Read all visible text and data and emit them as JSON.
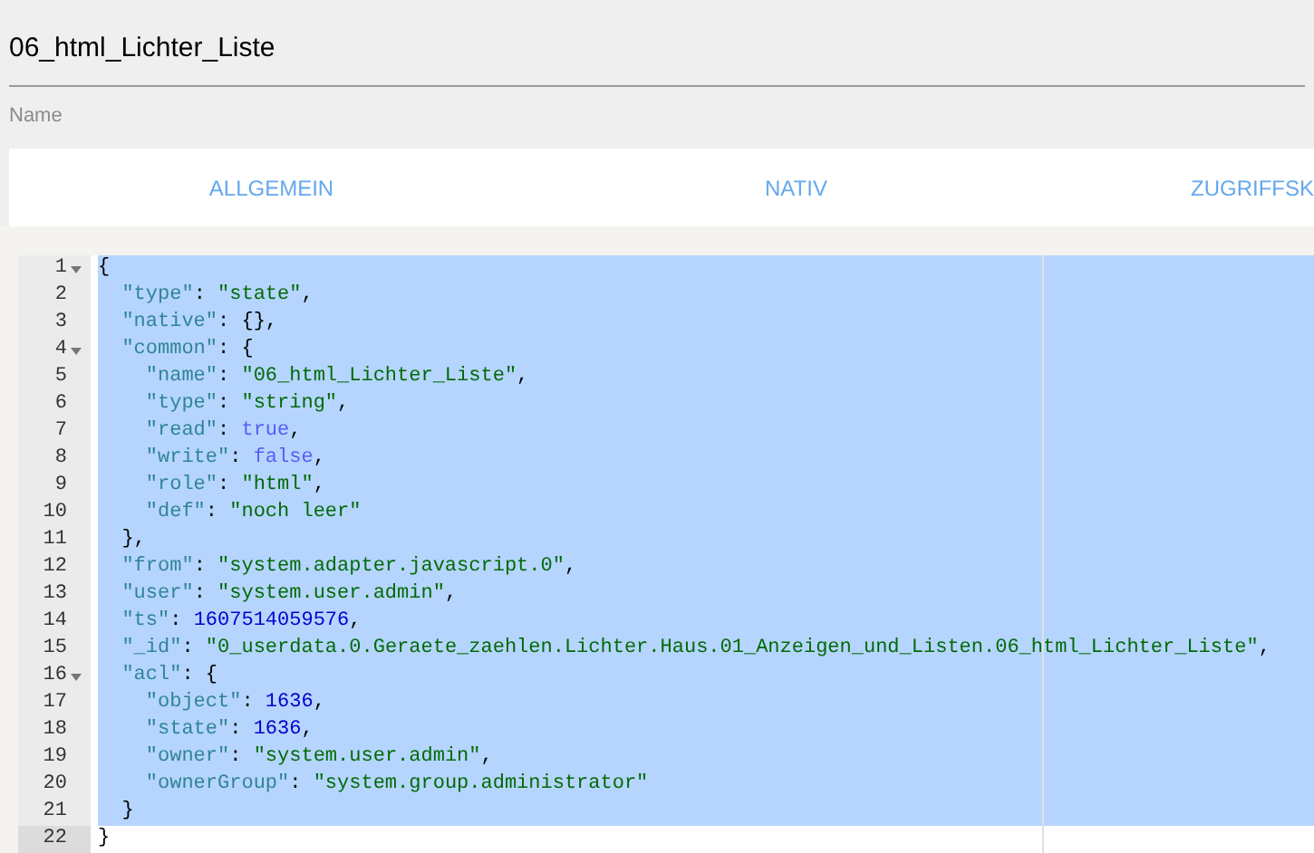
{
  "title": "06_html_Lichter_Liste",
  "name_label": "Name",
  "tabs": [
    {
      "label": "ALLGEMEIN"
    },
    {
      "label": "NATIV"
    },
    {
      "label": "ZUGRIFFSK"
    }
  ],
  "editor": {
    "lines": [
      {
        "number": "1",
        "fold": true,
        "active": false,
        "selected": true,
        "tokens": [
          {
            "kind": "punct",
            "text": "{"
          }
        ]
      },
      {
        "number": "2",
        "fold": false,
        "active": false,
        "selected": true,
        "tokens": [
          {
            "kind": "key",
            "text": "  \"type\""
          },
          {
            "kind": "punct",
            "text": ": "
          },
          {
            "kind": "string",
            "text": "\"state\""
          },
          {
            "kind": "punct",
            "text": ","
          }
        ]
      },
      {
        "number": "3",
        "fold": false,
        "active": false,
        "selected": true,
        "tokens": [
          {
            "kind": "key",
            "text": "  \"native\""
          },
          {
            "kind": "punct",
            "text": ": {},"
          }
        ]
      },
      {
        "number": "4",
        "fold": true,
        "active": false,
        "selected": true,
        "tokens": [
          {
            "kind": "key",
            "text": "  \"common\""
          },
          {
            "kind": "punct",
            "text": ": {"
          }
        ]
      },
      {
        "number": "5",
        "fold": false,
        "active": false,
        "selected": true,
        "tokens": [
          {
            "kind": "key",
            "text": "    \"name\""
          },
          {
            "kind": "punct",
            "text": ": "
          },
          {
            "kind": "string",
            "text": "\"06_html_Lichter_Liste\""
          },
          {
            "kind": "punct",
            "text": ","
          }
        ]
      },
      {
        "number": "6",
        "fold": false,
        "active": false,
        "selected": true,
        "tokens": [
          {
            "kind": "key",
            "text": "    \"type\""
          },
          {
            "kind": "punct",
            "text": ": "
          },
          {
            "kind": "string",
            "text": "\"string\""
          },
          {
            "kind": "punct",
            "text": ","
          }
        ]
      },
      {
        "number": "7",
        "fold": false,
        "active": false,
        "selected": true,
        "tokens": [
          {
            "kind": "key",
            "text": "    \"read\""
          },
          {
            "kind": "punct",
            "text": ": "
          },
          {
            "kind": "boolean",
            "text": "true"
          },
          {
            "kind": "punct",
            "text": ","
          }
        ]
      },
      {
        "number": "8",
        "fold": false,
        "active": false,
        "selected": true,
        "tokens": [
          {
            "kind": "key",
            "text": "    \"write\""
          },
          {
            "kind": "punct",
            "text": ": "
          },
          {
            "kind": "boolean",
            "text": "false"
          },
          {
            "kind": "punct",
            "text": ","
          }
        ]
      },
      {
        "number": "9",
        "fold": false,
        "active": false,
        "selected": true,
        "tokens": [
          {
            "kind": "key",
            "text": "    \"role\""
          },
          {
            "kind": "punct",
            "text": ": "
          },
          {
            "kind": "string",
            "text": "\"html\""
          },
          {
            "kind": "punct",
            "text": ","
          }
        ]
      },
      {
        "number": "10",
        "fold": false,
        "active": false,
        "selected": true,
        "tokens": [
          {
            "kind": "key",
            "text": "    \"def\""
          },
          {
            "kind": "punct",
            "text": ": "
          },
          {
            "kind": "string",
            "text": "\"noch leer\""
          }
        ]
      },
      {
        "number": "11",
        "fold": false,
        "active": false,
        "selected": true,
        "tokens": [
          {
            "kind": "punct",
            "text": "  },"
          }
        ]
      },
      {
        "number": "12",
        "fold": false,
        "active": false,
        "selected": true,
        "tokens": [
          {
            "kind": "key",
            "text": "  \"from\""
          },
          {
            "kind": "punct",
            "text": ": "
          },
          {
            "kind": "string",
            "text": "\"system.adapter.javascript.0\""
          },
          {
            "kind": "punct",
            "text": ","
          }
        ]
      },
      {
        "number": "13",
        "fold": false,
        "active": false,
        "selected": true,
        "tokens": [
          {
            "kind": "key",
            "text": "  \"user\""
          },
          {
            "kind": "punct",
            "text": ": "
          },
          {
            "kind": "string",
            "text": "\"system.user.admin\""
          },
          {
            "kind": "punct",
            "text": ","
          }
        ]
      },
      {
        "number": "14",
        "fold": false,
        "active": false,
        "selected": true,
        "tokens": [
          {
            "kind": "key",
            "text": "  \"ts\""
          },
          {
            "kind": "punct",
            "text": ": "
          },
          {
            "kind": "number",
            "text": "1607514059576"
          },
          {
            "kind": "punct",
            "text": ","
          }
        ]
      },
      {
        "number": "15",
        "fold": false,
        "active": false,
        "selected": true,
        "tokens": [
          {
            "kind": "key",
            "text": "  \"_id\""
          },
          {
            "kind": "punct",
            "text": ": "
          },
          {
            "kind": "string",
            "text": "\"0_userdata.0.Geraete_zaehlen.Lichter.Haus.01_Anzeigen_und_Listen.06_html_Lichter_Liste\""
          },
          {
            "kind": "punct",
            "text": ","
          }
        ]
      },
      {
        "number": "16",
        "fold": true,
        "active": false,
        "selected": true,
        "tokens": [
          {
            "kind": "key",
            "text": "  \"acl\""
          },
          {
            "kind": "punct",
            "text": ": {"
          }
        ]
      },
      {
        "number": "17",
        "fold": false,
        "active": false,
        "selected": true,
        "tokens": [
          {
            "kind": "key",
            "text": "    \"object\""
          },
          {
            "kind": "punct",
            "text": ": "
          },
          {
            "kind": "number",
            "text": "1636"
          },
          {
            "kind": "punct",
            "text": ","
          }
        ]
      },
      {
        "number": "18",
        "fold": false,
        "active": false,
        "selected": true,
        "tokens": [
          {
            "kind": "key",
            "text": "    \"state\""
          },
          {
            "kind": "punct",
            "text": ": "
          },
          {
            "kind": "number",
            "text": "1636"
          },
          {
            "kind": "punct",
            "text": ","
          }
        ]
      },
      {
        "number": "19",
        "fold": false,
        "active": false,
        "selected": true,
        "tokens": [
          {
            "kind": "key",
            "text": "    \"owner\""
          },
          {
            "kind": "punct",
            "text": ": "
          },
          {
            "kind": "string",
            "text": "\"system.user.admin\""
          },
          {
            "kind": "punct",
            "text": ","
          }
        ]
      },
      {
        "number": "20",
        "fold": false,
        "active": false,
        "selected": true,
        "tokens": [
          {
            "kind": "key",
            "text": "    \"ownerGroup\""
          },
          {
            "kind": "punct",
            "text": ": "
          },
          {
            "kind": "string",
            "text": "\"system.group.administrator\""
          }
        ]
      },
      {
        "number": "21",
        "fold": false,
        "active": false,
        "selected": true,
        "tokens": [
          {
            "kind": "punct",
            "text": "  }"
          }
        ]
      },
      {
        "number": "22",
        "fold": false,
        "active": true,
        "selected": false,
        "tokens": [
          {
            "kind": "punct",
            "text": "}"
          }
        ]
      }
    ]
  }
}
